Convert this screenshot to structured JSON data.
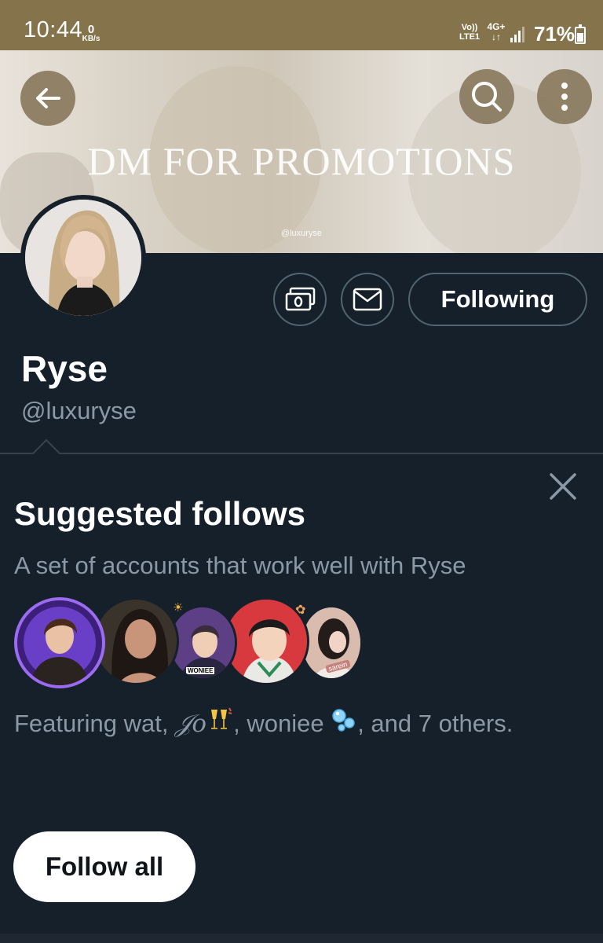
{
  "status_bar": {
    "time": "10:44",
    "net_speed_value": "0",
    "net_speed_unit": "KB/s",
    "volte": "Vo))",
    "lte": "LTE1",
    "network": "4G+",
    "battery_percent": "71%"
  },
  "banner": {
    "text": "DM FOR PROMOTIONS",
    "handle_watermark": "@luxuryse"
  },
  "header_buttons": {
    "back_icon": "arrow-left-icon",
    "search_icon": "search-icon",
    "more_icon": "more-vertical-icon"
  },
  "profile": {
    "display_name": "Ryse",
    "handle": "@luxuryse",
    "follow_state_label": "Following",
    "tips_icon": "money-icon",
    "message_icon": "envelope-icon"
  },
  "suggested": {
    "title": "Suggested follows",
    "subtitle": "A set of accounts that work well with Ryse",
    "featuring_prefix": "Featuring wat, ",
    "featuring_name2": "𝒥𝑜",
    "featuring_mid": ", woniee ",
    "featuring_suffix": ", and 7 others.",
    "avatar_badge_label": "WONIEE",
    "avatar_tag_label": "sarein",
    "follow_all_label": "Follow all"
  },
  "colors": {
    "status_bar": "#85744b",
    "background": "#15202b",
    "secondary_text": "#8b98a5",
    "border": "#38444d"
  }
}
